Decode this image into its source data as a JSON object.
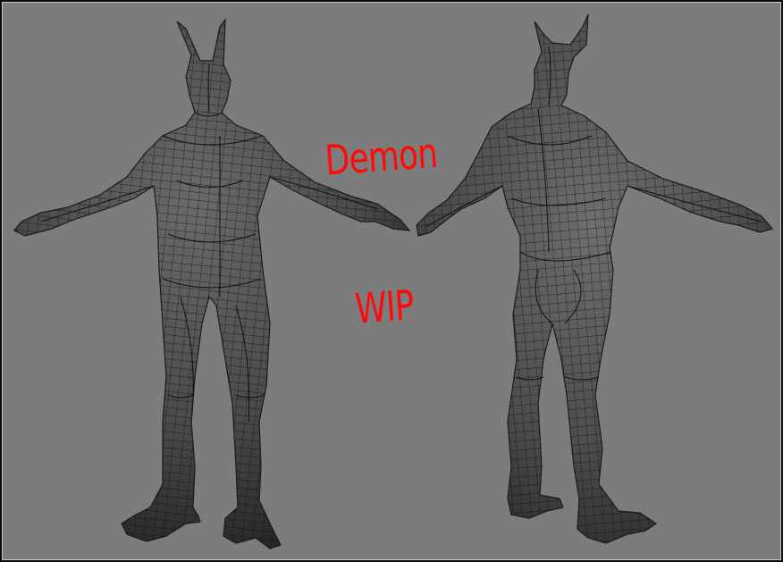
{
  "viewport": {
    "background": "#7c7c7c",
    "mesh_fill": "#4a4a4a",
    "wire_color": "#0c0c0c"
  },
  "annotation": {
    "line1": "Demon",
    "line2": "WIP",
    "color": "#ff0a0a"
  },
  "models": [
    {
      "view": "front"
    },
    {
      "view": "back"
    }
  ]
}
